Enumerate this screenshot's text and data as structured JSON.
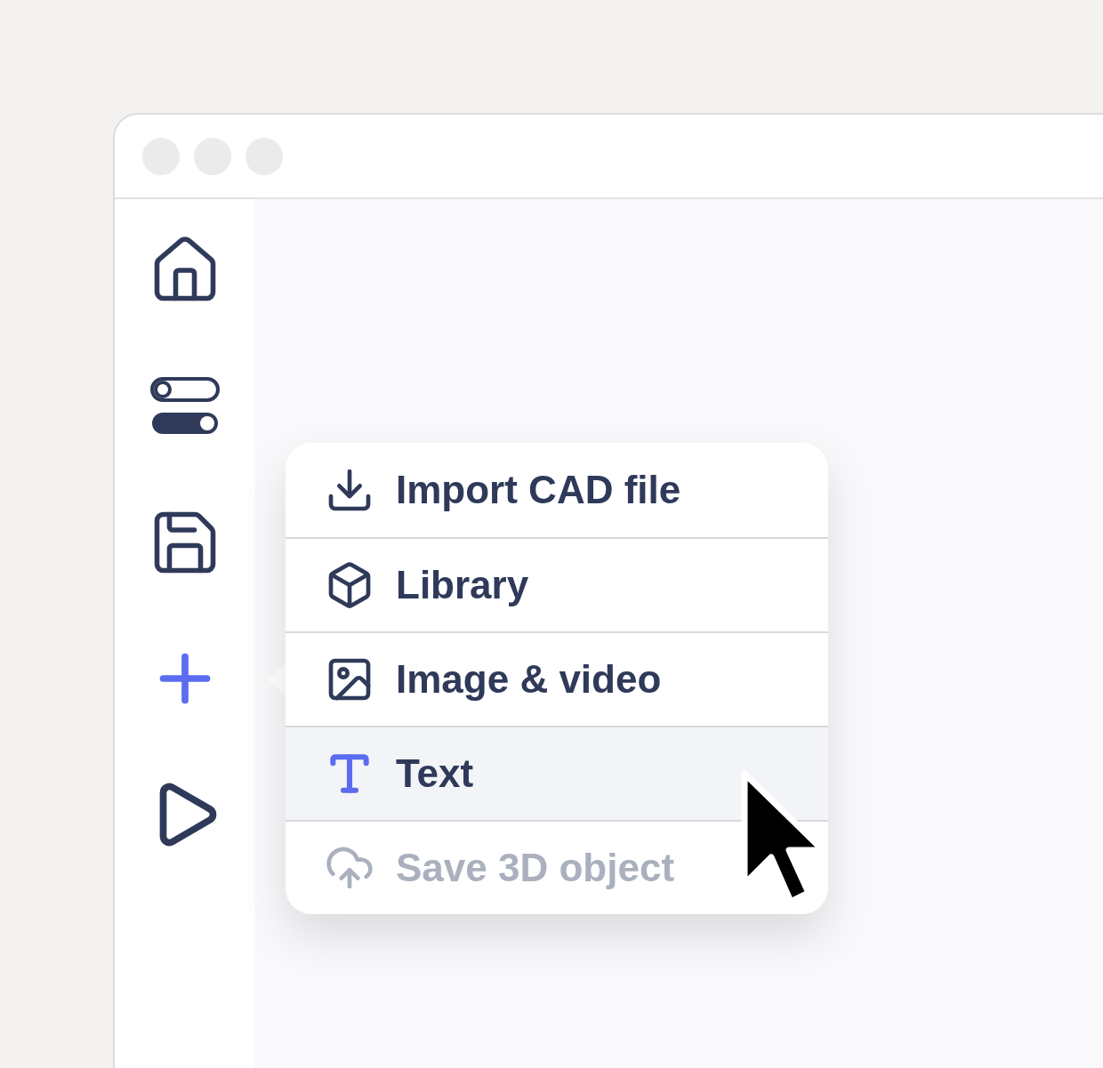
{
  "sidebar": {
    "items": [
      {
        "selected": false
      },
      {
        "selected": false
      },
      {
        "selected": false
      },
      {
        "selected": true
      },
      {
        "selected": false
      }
    ]
  },
  "menu": {
    "items": [
      {
        "label": "Import CAD file",
        "hovered": false,
        "disabled": false
      },
      {
        "label": "Library",
        "hovered": false,
        "disabled": false
      },
      {
        "label": "Image & video",
        "hovered": false,
        "disabled": false
      },
      {
        "label": "Text",
        "hovered": true,
        "disabled": false
      },
      {
        "label": "Save 3D object",
        "hovered": false,
        "disabled": true
      }
    ]
  }
}
